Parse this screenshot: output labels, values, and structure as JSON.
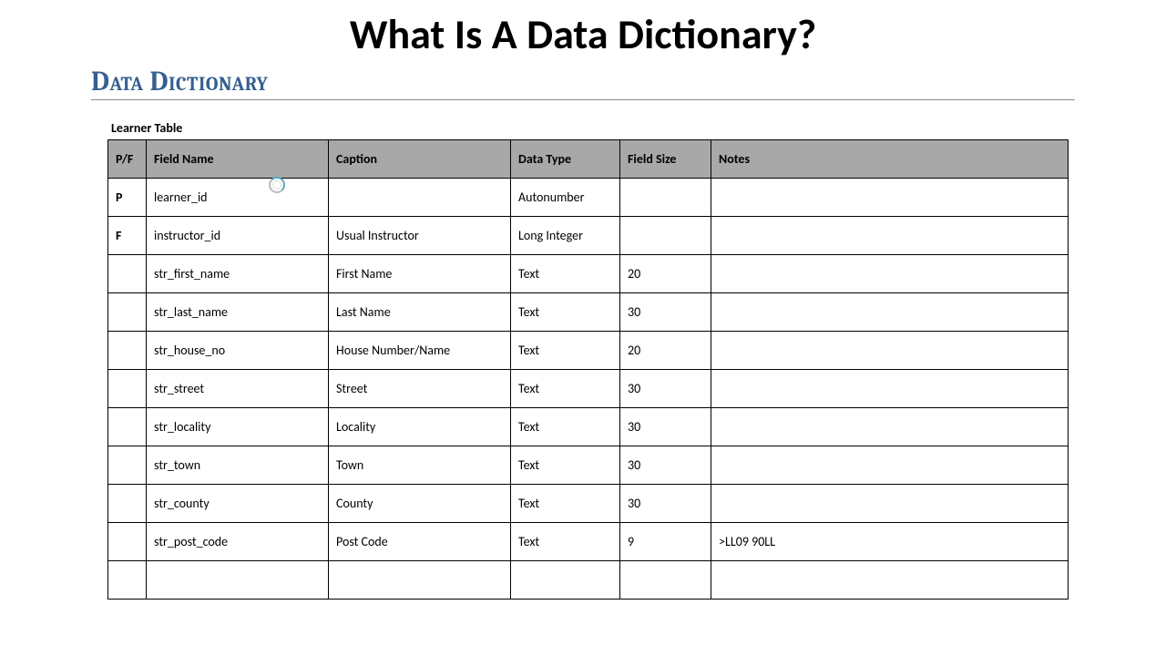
{
  "main_title": "What Is A Data Dictionary?",
  "section_heading": "Data Dictionary",
  "table_caption": "Learner Table",
  "columns": {
    "pf": "P/F",
    "field_name": "Field Name",
    "caption": "Caption",
    "data_type": "Data Type",
    "field_size": "Field Size",
    "notes": "Notes"
  },
  "rows": [
    {
      "pf": "P",
      "field_name": "learner_id",
      "caption": "",
      "data_type": "Autonumber",
      "field_size": "",
      "notes": ""
    },
    {
      "pf": "F",
      "field_name": "instructor_id",
      "caption": "Usual Instructor",
      "data_type": "Long Integer",
      "field_size": "",
      "notes": ""
    },
    {
      "pf": "",
      "field_name": "str_first_name",
      "caption": "First Name",
      "data_type": "Text",
      "field_size": "20",
      "notes": ""
    },
    {
      "pf": "",
      "field_name": "str_last_name",
      "caption": "Last Name",
      "data_type": "Text",
      "field_size": "30",
      "notes": ""
    },
    {
      "pf": "",
      "field_name": "str_house_no",
      "caption": "House Number/Name",
      "data_type": "Text",
      "field_size": "20",
      "notes": ""
    },
    {
      "pf": "",
      "field_name": "str_street",
      "caption": "Street",
      "data_type": "Text",
      "field_size": "30",
      "notes": ""
    },
    {
      "pf": "",
      "field_name": "str_locality",
      "caption": "Locality",
      "data_type": "Text",
      "field_size": "30",
      "notes": ""
    },
    {
      "pf": "",
      "field_name": "str_town",
      "caption": "Town",
      "data_type": "Text",
      "field_size": "30",
      "notes": ""
    },
    {
      "pf": "",
      "field_name": "str_county",
      "caption": "County",
      "data_type": "Text",
      "field_size": "30",
      "notes": ""
    },
    {
      "pf": "",
      "field_name": "str_post_code",
      "caption": "Post Code",
      "data_type": "Text",
      "field_size": "9",
      "notes": ">LL09 90LL"
    },
    {
      "pf": "",
      "field_name": "",
      "caption": "",
      "data_type": "",
      "field_size": "",
      "notes": ""
    }
  ]
}
